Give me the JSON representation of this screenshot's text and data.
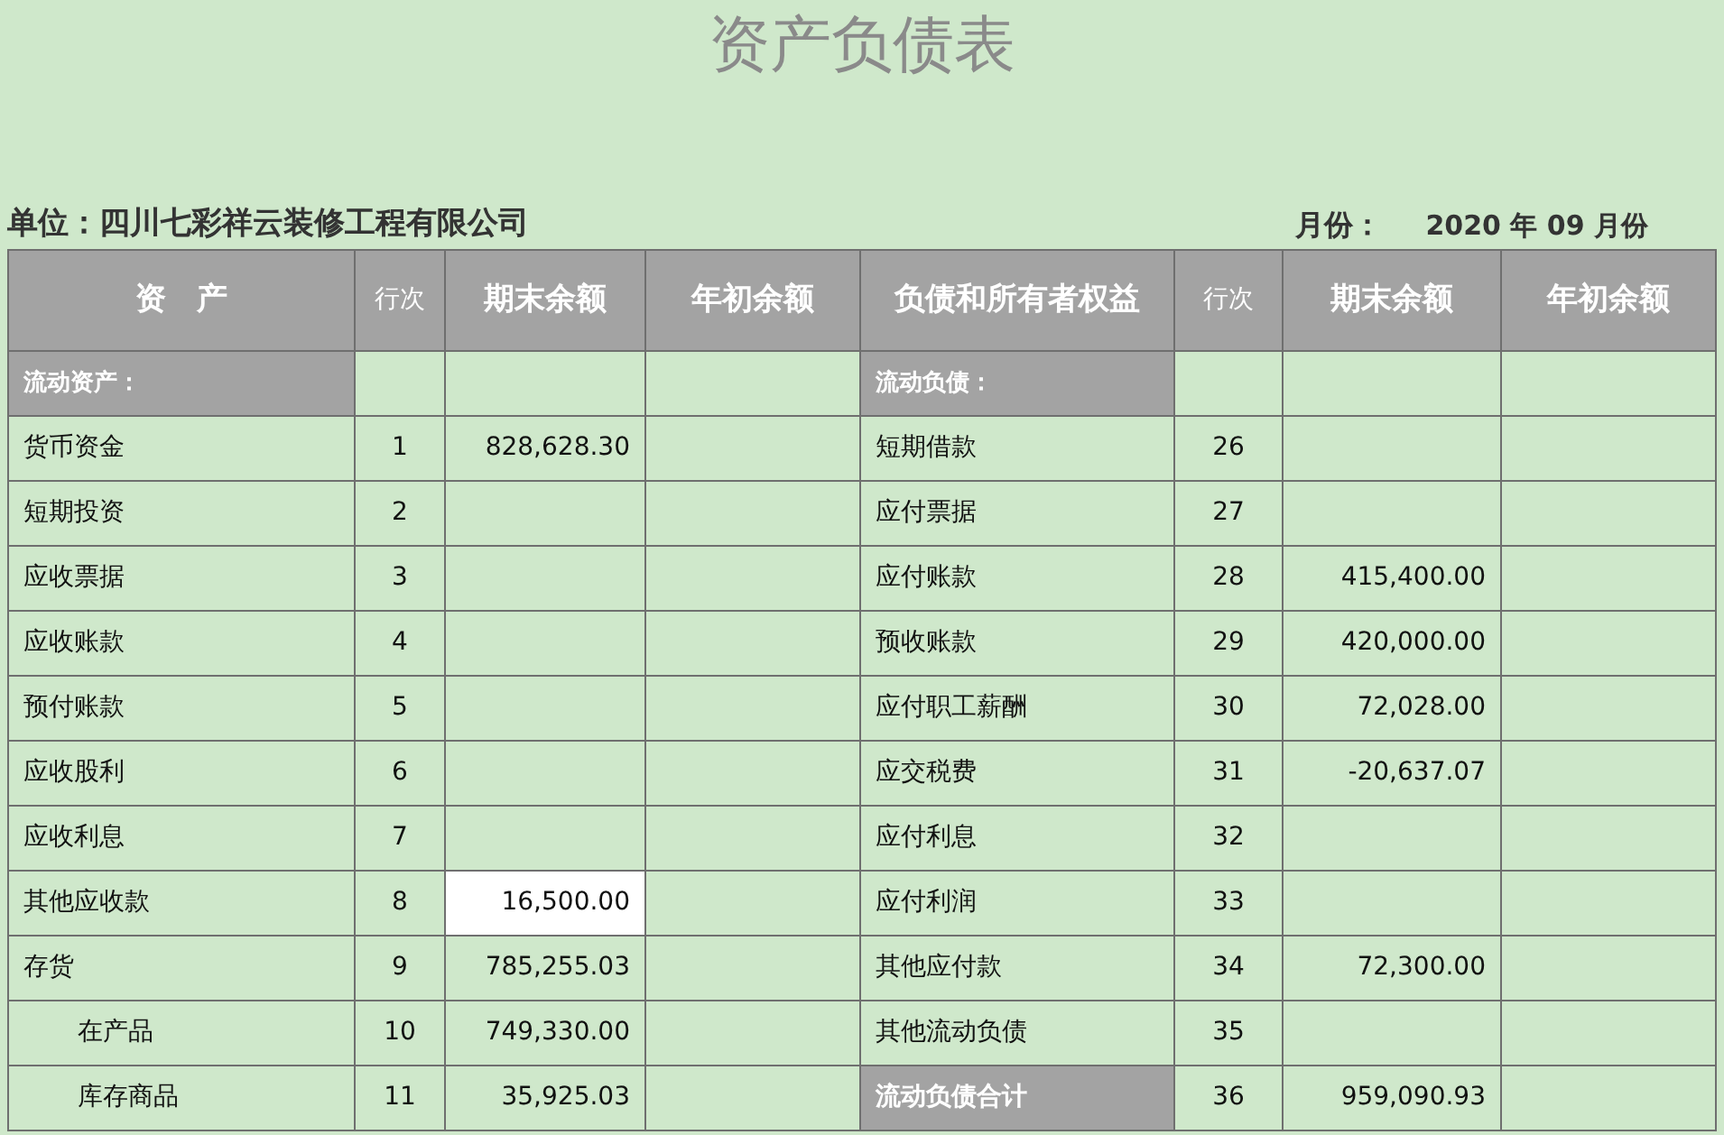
{
  "title": "资产负债表",
  "unit": {
    "label": "单位：",
    "value": "四川七彩祥云装修工程有限公司"
  },
  "period": {
    "label": "月份：",
    "value": "2020 年 09 月份"
  },
  "table": {
    "columns": [
      "资　产",
      "行次",
      "期末余额",
      "年初余额",
      "负债和所有者权益",
      "行次",
      "期末余额",
      "年初余额"
    ],
    "rows": [
      {
        "left": {
          "kind": "section",
          "name": "流动资产："
        },
        "right": {
          "kind": "section",
          "name": "流动负债："
        }
      },
      {
        "left": {
          "kind": "item",
          "name": "货币资金",
          "line": "1",
          "end": "828,628.30",
          "selected": false
        },
        "right": {
          "kind": "item",
          "name": "短期借款",
          "line": "26",
          "selected": false
        }
      },
      {
        "left": {
          "kind": "item",
          "name": "短期投资",
          "line": "2",
          "selected": false
        },
        "right": {
          "kind": "item",
          "name": "应付票据",
          "line": "27",
          "selected": false
        }
      },
      {
        "left": {
          "kind": "item",
          "name": "应收票据",
          "line": "3",
          "selected": false
        },
        "right": {
          "kind": "item",
          "name": "应付账款",
          "line": "28",
          "end": "415,400.00",
          "selected": false
        }
      },
      {
        "left": {
          "kind": "item",
          "name": "应收账款",
          "line": "4",
          "selected": false
        },
        "right": {
          "kind": "item",
          "name": "预收账款",
          "line": "29",
          "end": "420,000.00",
          "selected": false
        }
      },
      {
        "left": {
          "kind": "item",
          "name": "预付账款",
          "line": "5",
          "selected": false
        },
        "right": {
          "kind": "item",
          "name": "应付职工薪酬",
          "line": "30",
          "end": "72,028.00",
          "selected": false
        }
      },
      {
        "left": {
          "kind": "item",
          "name": "应收股利",
          "line": "6",
          "selected": false
        },
        "right": {
          "kind": "item",
          "name": "应交税费",
          "line": "31",
          "end": "-20,637.07",
          "selected": false
        }
      },
      {
        "left": {
          "kind": "item",
          "name": "应收利息",
          "line": "7",
          "selected": false
        },
        "right": {
          "kind": "item",
          "name": "应付利息",
          "line": "32",
          "selected": false
        }
      },
      {
        "left": {
          "kind": "item",
          "name": "其他应收款",
          "line": "8",
          "end": "16,500.00",
          "selected": true
        },
        "right": {
          "kind": "item",
          "name": "应付利润",
          "line": "33",
          "selected": false
        }
      },
      {
        "left": {
          "kind": "item",
          "name": "存货",
          "line": "9",
          "end": "785,255.03",
          "selected": false
        },
        "right": {
          "kind": "item",
          "name": "其他应付款",
          "line": "34",
          "end": "72,300.00",
          "selected": false
        }
      },
      {
        "left": {
          "kind": "sub",
          "name": "在产品",
          "line": "10",
          "end": "749,330.00",
          "selected": false
        },
        "right": {
          "kind": "item",
          "name": "其他流动负债",
          "line": "35",
          "selected": false
        }
      },
      {
        "left": {
          "kind": "sub",
          "name": "库存商品",
          "line": "11",
          "end": "35,925.03",
          "selected": false
        },
        "right": {
          "kind": "total",
          "name": "流动负债合计",
          "line": "36",
          "end": "959,090.93",
          "selected": false
        }
      }
    ]
  }
}
